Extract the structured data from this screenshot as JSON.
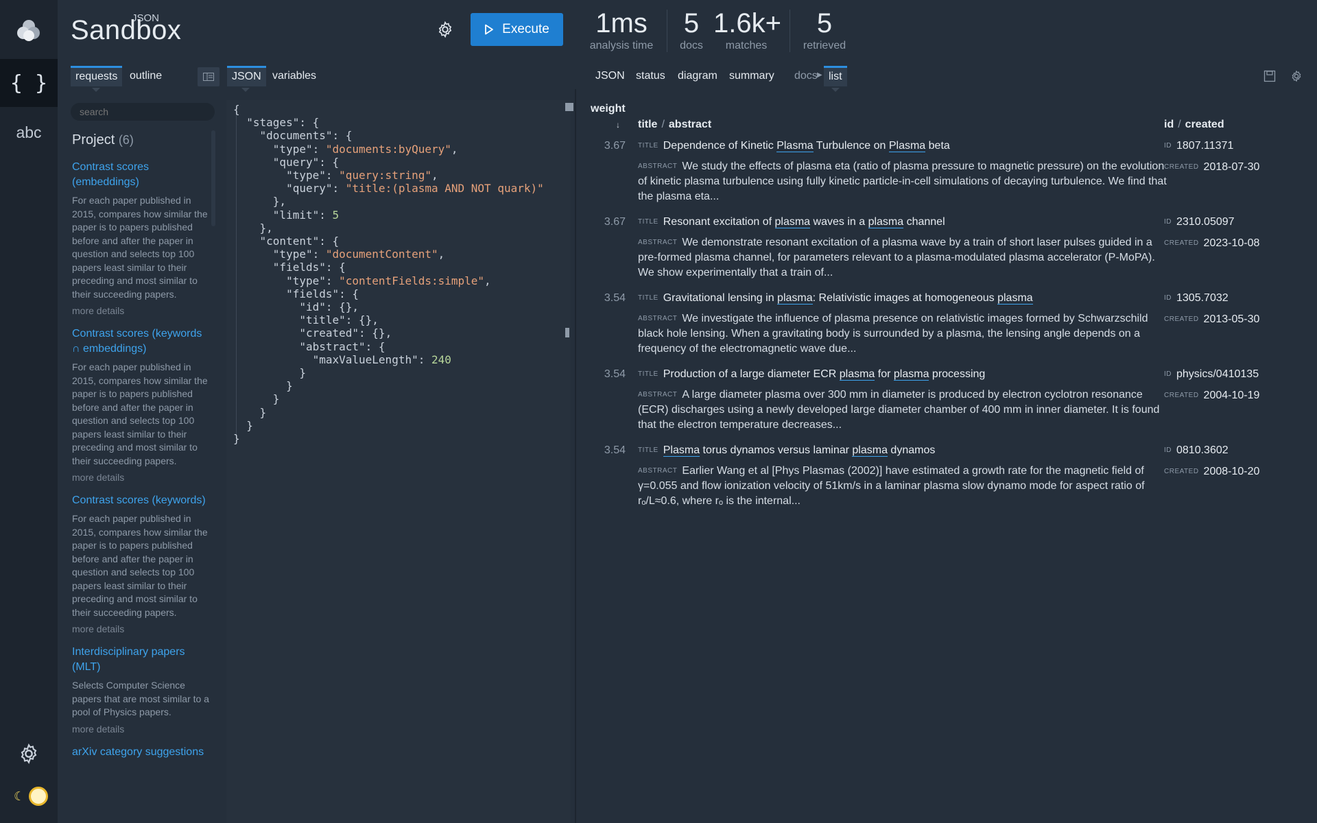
{
  "brand": {
    "super": "JSON",
    "name": "Sandbox"
  },
  "header": {
    "execute_label": "Execute",
    "stats": [
      {
        "value": "1ms",
        "label": "analysis time"
      },
      {
        "value": "5",
        "label": "docs"
      },
      {
        "value": "1.6k+",
        "label": "matches"
      },
      {
        "value": "5",
        "label": "retrieved"
      }
    ]
  },
  "rail": {
    "json_label": "{ }",
    "text_label": "abc"
  },
  "left_tabs": {
    "requests": "requests",
    "outline": "outline"
  },
  "editor_tabs": {
    "json": "JSON",
    "variables": "variables"
  },
  "result_tabs": {
    "json": "JSON",
    "status": "status",
    "diagram": "diagram",
    "summary": "summary",
    "docs": "docs",
    "list": "list"
  },
  "search": {
    "placeholder": "search"
  },
  "project": {
    "title": "Project",
    "count": "(6)",
    "items": [
      {
        "title": "Contrast scores (embeddings)",
        "desc": "For each paper published in 2015, compares how similar the paper is to papers published before and after the paper in question and selects top 100 papers least similar to their preceding and most similar to their succeeding papers.",
        "more": "more details"
      },
      {
        "title": "Contrast scores (keywords ∩ embeddings)",
        "desc": "For each paper published in 2015, compares how similar the paper is to papers published before and after the paper in question and selects top 100 papers least similar to their preceding and most similar to their succeeding papers.",
        "more": "more details"
      },
      {
        "title": "Contrast scores (keywords)",
        "desc": "For each paper published in 2015, compares how similar the paper is to papers published before and after the paper in question and selects top 100 papers least similar to their preceding and most similar to their succeeding papers.",
        "more": "more details"
      },
      {
        "title": "Interdisciplinary papers (MLT)",
        "desc": "Selects Computer Science papers that are most similar to a pool of Physics papers.",
        "more": "more details"
      },
      {
        "title": "arXiv category suggestions",
        "desc": "",
        "more": ""
      }
    ]
  },
  "editor": {
    "code": "{\n  \"stages\": {\n    \"documents\": {\n      \"type\": \"documents:byQuery\",\n      \"query\": {\n        \"type\": \"query:string\",\n        \"query\": \"title:(plasma AND NOT quark)\"\n      },\n      \"limit\": 5\n    },\n    \"content\": {\n      \"type\": \"documentContent\",\n      \"fields\": {\n        \"type\": \"contentFields:simple\",\n        \"fields\": {\n          \"id\": {},\n          \"title\": {},\n          \"created\": {},\n          \"abstract\": {\n            \"maxValueLength\": 240\n          }\n        }\n      }\n    }\n  }\n}"
  },
  "results": {
    "columns": {
      "weight": "weight",
      "title": "title",
      "abstract": "abstract",
      "id": "id",
      "created": "created"
    },
    "labels": {
      "title": "TITLE",
      "abstract": "ABSTRACT",
      "id": "ID",
      "created": "CREATED"
    },
    "rows": [
      {
        "weight": "3.67",
        "title": "Dependence of Kinetic Plasma Turbulence on Plasma beta",
        "abstract": "We study the effects of plasma eta (ratio of plasma pressure to magnetic pressure) on the evolution of kinetic plasma turbulence using fully kinetic particle-in-cell simulations of decaying turbulence. We find that the plasma eta...",
        "id": "1807.11371",
        "created": "2018-07-30"
      },
      {
        "weight": "3.67",
        "title": "Resonant excitation of plasma waves in a plasma channel",
        "abstract": "We demonstrate resonant excitation of a plasma wave by a train of short laser pulses guided in a pre-formed plasma channel, for parameters relevant to a plasma-modulated plasma accelerator (P-MoPA). We show experimentally that a train of...",
        "id": "2310.05097",
        "created": "2023-10-08"
      },
      {
        "weight": "3.54",
        "title": "Gravitational lensing in plasma: Relativistic images at homogeneous plasma",
        "abstract": "We investigate the influence of plasma presence on relativistic images formed by Schwarzschild black hole lensing. When a gravitating body is surrounded by a plasma, the lensing angle depends on a frequency of the electromagnetic wave due...",
        "id": "1305.7032",
        "created": "2013-05-30"
      },
      {
        "weight": "3.54",
        "title": "Production of a large diameter ECR plasma for plasma processing",
        "abstract": "A large diameter plasma over 300 mm in diameter is produced by electron cyclotron resonance (ECR) discharges using a newly developed large diameter chamber of 400 mm in inner diameter. It is found that the electron temperature decreases...",
        "id": "physics/0410135",
        "created": "2004-10-19"
      },
      {
        "weight": "3.54",
        "title": "Plasma torus dynamos versus laminar plasma dynamos",
        "abstract": "Earlier Wang et al [Phys Plasmas (2002)] have estimated a growth rate for the magnetic field of γ=0.055 and flow ionization velocity of 51km/s in a laminar plasma slow dynamo mode for aspect ratio of rₒ/L≈0.6, where rₒ is the internal...",
        "id": "0810.3602",
        "created": "2008-10-20"
      }
    ]
  }
}
